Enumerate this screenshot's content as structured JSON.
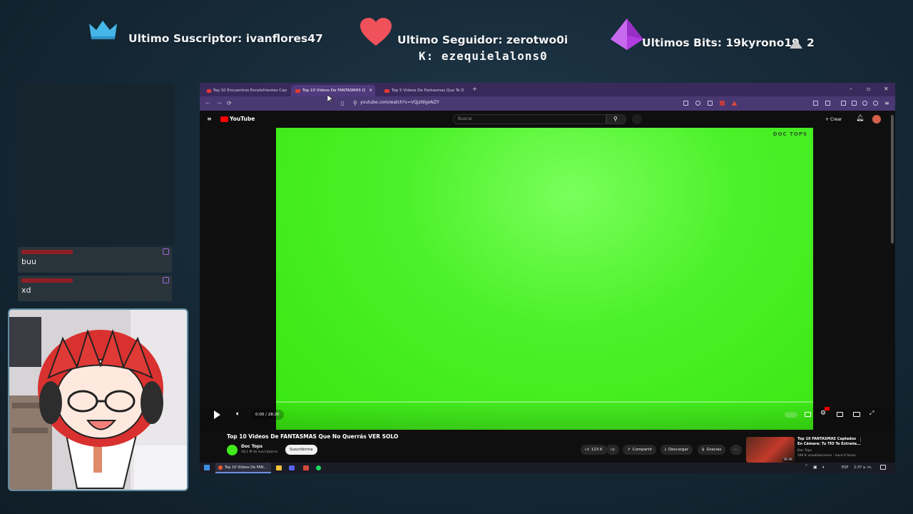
{
  "overlay": {
    "subscriber_label": "Ultimo Suscriptor: ivanflores47",
    "follower_label": "Ultimo Seguidor: zerotwo0i",
    "ticker_text": "K: ezequielalons0",
    "bits_label": "Ultimos Bits: 19kyrono19",
    "bits_count": "2",
    "colors": {
      "crown": "#45b6e8",
      "heart": "#f0525b",
      "gem": "#b13de0"
    }
  },
  "chat": {
    "messages": [
      {
        "user": "",
        "text": "buu"
      },
      {
        "user": "",
        "text": "xd"
      }
    ]
  },
  "browser": {
    "tabs": [
      {
        "label": "Top 10 Encuentros Escalofriantes Cap",
        "active": false
      },
      {
        "label": "Top 10 Videos De FANTASMAS Q",
        "active": true
      },
      {
        "label": "Top 5 Videos De Fantasmas Que Te D",
        "active": false
      }
    ],
    "url": "youtube.com/watch?v=VQjzNlgeNZY",
    "brand": "YouTube",
    "search_placeholder": "Buscar",
    "create_label": "Crear",
    "notification_count": ""
  },
  "video": {
    "watermark": "DOC TOPS",
    "time": "0:00 / 28:20",
    "title": "Top 10 Videos De FANTASMAS Que No Querrás VER SOLO",
    "channel": "Doc Tops",
    "subscribers": "18,1 M de suscriptores",
    "subscribe_label": "Suscribirme",
    "likes": "123 K",
    "share_label": "Compartir",
    "download_label": "Descargar",
    "thanks_label": "Gracias",
    "color": "#41ec1b"
  },
  "suggestion": {
    "title": "Top 10 FANTASMAS Captados En Cámara: Tu TÍO Te Extraña...",
    "channel": "Doc Tops",
    "meta": "184 K visualizaciones · hace 6 horas",
    "duration": "30:46"
  },
  "taskbar": {
    "active_window": "Top 10 Videos De FAN...",
    "language": "ESP",
    "time": "2:37 a. m."
  }
}
